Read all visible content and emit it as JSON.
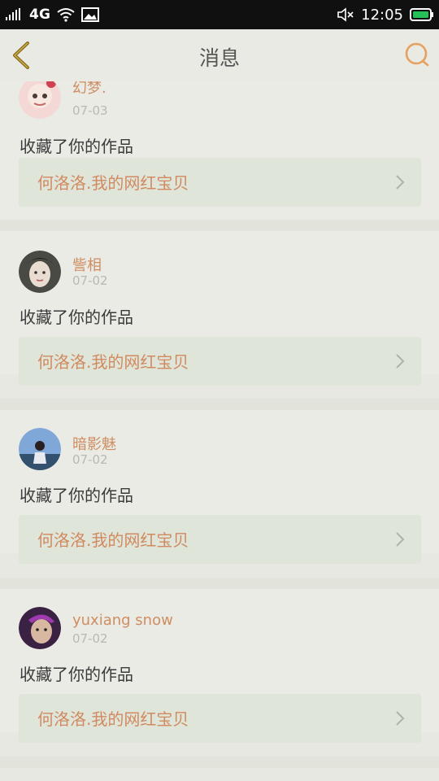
{
  "status_bar": {
    "network": "4G",
    "time": "12:05"
  },
  "header": {
    "title": "消息"
  },
  "messages": [
    {
      "username": "幻梦.",
      "date": "07-03",
      "action": "收藏了你的作品",
      "work_title": "何洛洛.我的网红宝贝"
    },
    {
      "username": "訾相",
      "date": "07-02",
      "action": "收藏了你的作品",
      "work_title": "何洛洛.我的网红宝贝"
    },
    {
      "username": "暗影魅",
      "date": "07-02",
      "action": "收藏了你的作品",
      "work_title": "何洛洛.我的网红宝贝"
    },
    {
      "username": "yuxiang snow",
      "date": "07-02",
      "action": "收藏了你的作品",
      "work_title": "何洛洛.我的网红宝贝"
    }
  ],
  "colors": {
    "accent": "#d18a60",
    "back_arrow": "#8a6a1f",
    "search_icon": "#e6a05f"
  },
  "icons": {
    "back": "chevron-left-icon",
    "search": "search-icon",
    "signal": "signal-icon",
    "wifi": "wifi-icon",
    "image": "image-icon",
    "mute": "volume-mute-icon",
    "battery": "battery-icon"
  }
}
